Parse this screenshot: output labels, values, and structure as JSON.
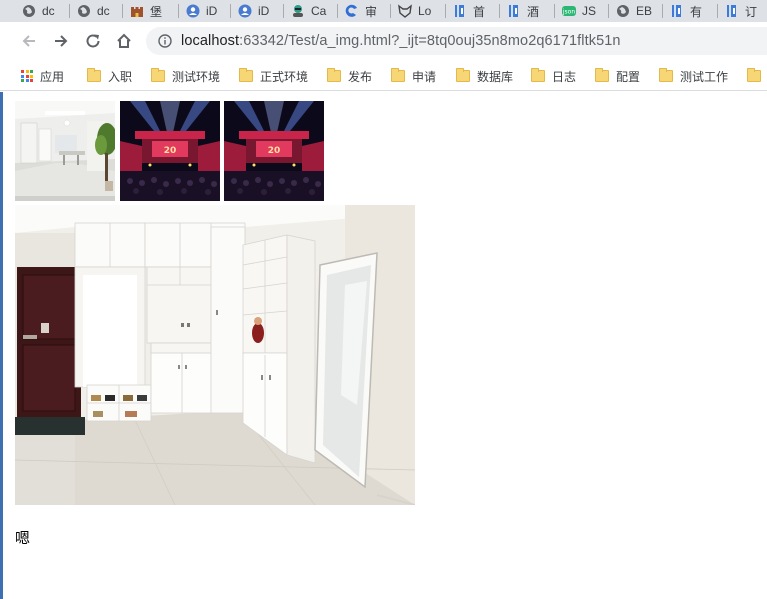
{
  "tabs": [
    {
      "title": "dc",
      "icon": "globe-icon"
    },
    {
      "title": "dc",
      "icon": "globe-icon"
    },
    {
      "title": "堡",
      "icon": "castle-icon"
    },
    {
      "title": "iD",
      "icon": "id-icon"
    },
    {
      "title": "iD",
      "icon": "id-icon"
    },
    {
      "title": "Ca",
      "icon": "avatar-icon"
    },
    {
      "title": "审",
      "icon": "swirl-icon"
    },
    {
      "title": "Lo",
      "icon": "fox-icon"
    },
    {
      "title": "首",
      "icon": "book-icon"
    },
    {
      "title": "酒",
      "icon": "book-icon"
    },
    {
      "title": "JS",
      "icon": "json-icon"
    },
    {
      "title": "EB",
      "icon": "globe-icon"
    },
    {
      "title": "有",
      "icon": "book-icon"
    },
    {
      "title": "订",
      "icon": "book-icon"
    }
  ],
  "address_bar": {
    "host": "localhost",
    "rest": ":63342/Test/a_img.html?_ijt=8tq0ouj35n8mo2q6171fltk51n"
  },
  "bookmarks": [
    {
      "label": "应用",
      "icon": "apps-grid-icon"
    },
    {
      "label": "入职",
      "icon": "folder-icon"
    },
    {
      "label": "测试环境",
      "icon": "folder-icon"
    },
    {
      "label": "正式环境",
      "icon": "folder-icon"
    },
    {
      "label": "发布",
      "icon": "folder-icon"
    },
    {
      "label": "申请",
      "icon": "folder-icon"
    },
    {
      "label": "数据库",
      "icon": "folder-icon"
    },
    {
      "label": "日志",
      "icon": "folder-icon"
    },
    {
      "label": "配置",
      "icon": "folder-icon"
    },
    {
      "label": "测试工作",
      "icon": "folder-icon"
    }
  ],
  "page": {
    "images": [
      {
        "subject": "living-room-photo"
      },
      {
        "subject": "concert-stage-photo"
      },
      {
        "subject": "concert-stage-photo"
      },
      {
        "subject": "entryway-cabinet-photo"
      }
    ],
    "caption": "嗯"
  },
  "colors": {
    "tabstrip": "#dee1e6",
    "omnibox": "#f1f3f4",
    "folder": "#f7d775",
    "accent_blue": "#1a73e8"
  }
}
